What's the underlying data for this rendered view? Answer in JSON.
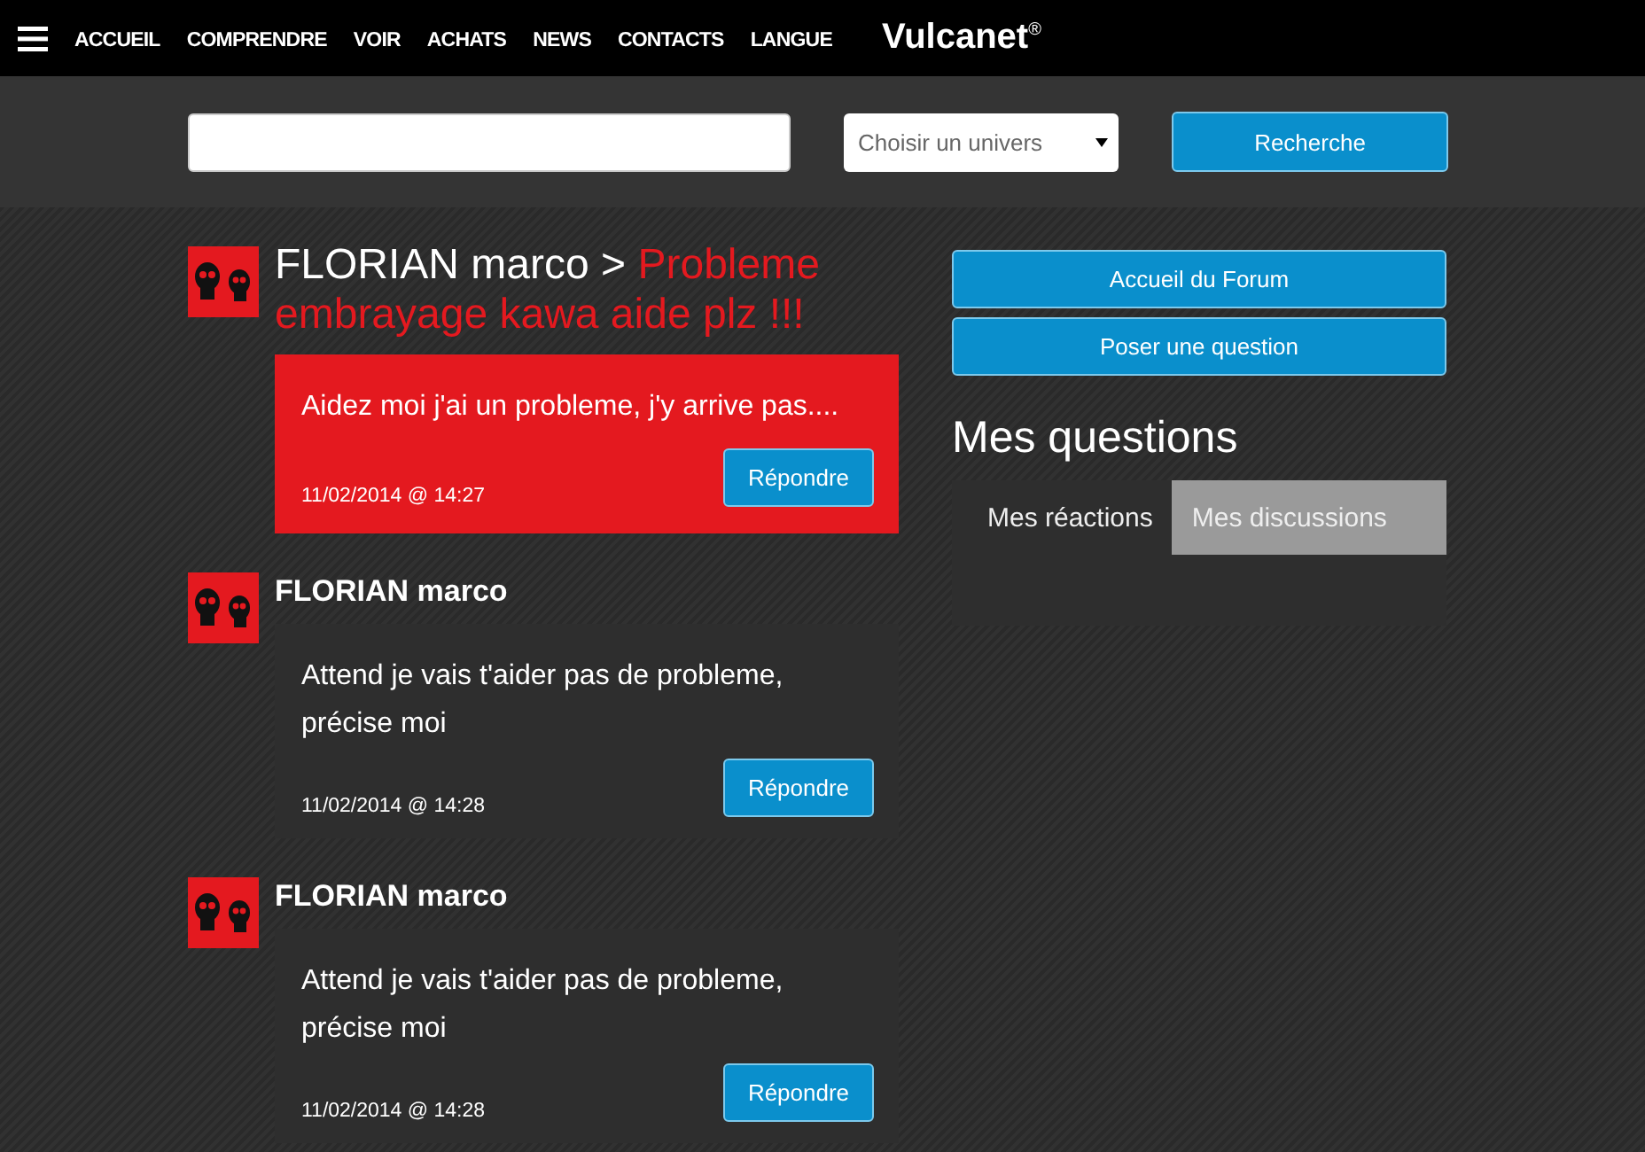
{
  "nav": {
    "items": [
      "ACCUEIL",
      "COMPRENDRE",
      "VOIR",
      "ACHATS",
      "NEWS",
      "CONTACTS",
      "LANGUE"
    ],
    "logo": "Vulcanet",
    "logo_mark": "®"
  },
  "search": {
    "select": "Choisir un univers",
    "button": "Recherche"
  },
  "posts": [
    {
      "kind": "question",
      "author": "FLORIAN marco",
      "separator": ">",
      "subject": "Probleme embrayage kawa aide plz !!!",
      "text": "Aidez moi j'ai un probleme, j'y arrive pas....",
      "date": "11/02/2014 @ 14:27",
      "button": "Répondre"
    },
    {
      "kind": "reply",
      "author": "FLORIAN marco",
      "text": "Attend je vais t'aider pas de probleme, précise moi",
      "date": "11/02/2014 @ 14:28",
      "button": "Répondre"
    },
    {
      "kind": "reply",
      "author": "FLORIAN marco",
      "text": "Attend je vais t'aider pas de probleme, précise moi",
      "date": "11/02/2014 @ 14:28",
      "button": "Répondre"
    }
  ],
  "sidebar": {
    "buttons": [
      "Accueil du Forum",
      "Poser une question"
    ],
    "heading": "Mes questions",
    "tabs": [
      {
        "label": "Mes réactions",
        "selected": true
      },
      {
        "label": "Mes discussions",
        "selected": false
      }
    ]
  }
}
